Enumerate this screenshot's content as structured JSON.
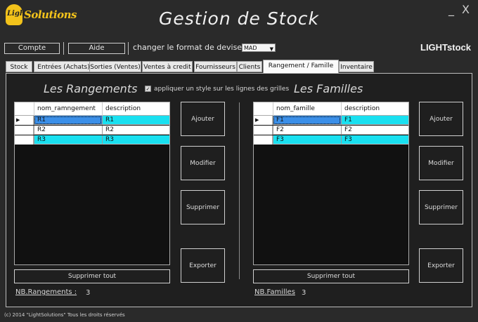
{
  "logo": {
    "icon_text": "Light",
    "brand": "Solutions",
    "color": "#f2c21b"
  },
  "app": {
    "title": "Gestion de Stock",
    "minimize": "_",
    "close": "X",
    "brand_right": "LIGHTstock"
  },
  "toolbar": {
    "compte": "Compte",
    "aide": "Aide",
    "devise_label": "changer le format de devise :",
    "devise_value": "MAD"
  },
  "tabs": [
    {
      "label": "Stock"
    },
    {
      "label": "Entrées (Achats)"
    },
    {
      "label": "Sorties (Ventes)"
    },
    {
      "label": "Ventes à credit"
    },
    {
      "label": "Fournisseurs"
    },
    {
      "label": "Clients"
    },
    {
      "label": "Rangement / Famille"
    },
    {
      "label": "Inventaire"
    }
  ],
  "active_tab": "Rangement / Famille",
  "style_option": {
    "checked": true,
    "label": "appliquer un style sur les lignes des grilles"
  },
  "rangements": {
    "title": "Les Rangements",
    "columns": [
      "nom_ramngement",
      "description"
    ],
    "rows": [
      {
        "c1": "R1",
        "c2": "R1",
        "selected": true
      },
      {
        "c1": "R2",
        "c2": "R2",
        "selected": false
      },
      {
        "c1": "R3",
        "c2": "R3",
        "selected": false
      }
    ],
    "buttons": {
      "ajouter": "Ajouter",
      "modifier": "Modifier",
      "supprimer": "Supprimer",
      "exporter": "Exporter"
    },
    "supprimer_tout": "Supprimer tout",
    "count_label": "NB.Rangements :",
    "count_value": "3"
  },
  "familles": {
    "title": "Les Familles",
    "columns": [
      "nom_famille",
      "description"
    ],
    "rows": [
      {
        "c1": "F1",
        "c2": "F1",
        "selected": true
      },
      {
        "c1": "F2",
        "c2": "F2",
        "selected": false
      },
      {
        "c1": "F3",
        "c2": "F3",
        "selected": false
      }
    ],
    "buttons": {
      "ajouter": "Ajouter",
      "modifier": "Modifier",
      "supprimer": "Supprimer",
      "exporter": "Exporter"
    },
    "supprimer_tout": "Supprimer tout",
    "count_label": "NB.Familles",
    "count_value": "3"
  },
  "colors": {
    "row_selected": "#3b8fe8",
    "row_alt": "#19e0f0",
    "row_plain": "#ffffff"
  },
  "footer": "(c) 2014 \"LightSolutions\" Tous les droits réservés"
}
